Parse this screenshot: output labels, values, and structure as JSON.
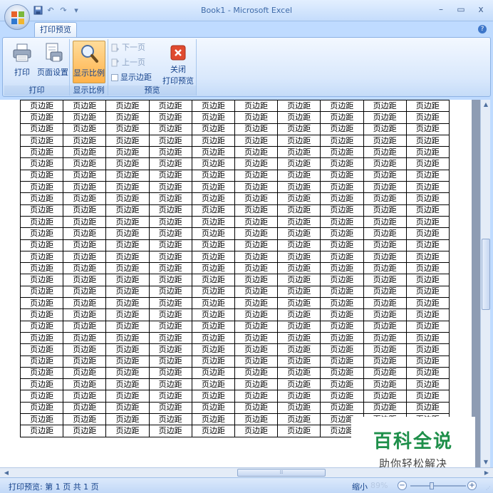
{
  "window": {
    "title": "Book1 - Microsoft Excel",
    "minimize": "–",
    "maximize": "▭",
    "close": "x"
  },
  "tabs": {
    "active": "打印预览",
    "help": "?"
  },
  "ribbon": {
    "print_group": {
      "label": "打印",
      "print_button": "打印",
      "page_setup_button": "页面设置"
    },
    "zoom_group": {
      "label": "显示比例",
      "zoom_button": "显示比例"
    },
    "preview_group": {
      "label": "预览",
      "next_page": "下一页",
      "prev_page": "上一页",
      "show_margins": "显示边距",
      "close_line1": "关闭",
      "close_line2": "打印预览"
    }
  },
  "sheet": {
    "cell_text": "页边距",
    "rows": 29,
    "cols": 10
  },
  "watermark": {
    "main": "百科全说",
    "sub": "助你轻松解决"
  },
  "status": {
    "text": "打印预览: 第 1 页 共 1 页",
    "zoom_label": "缩小",
    "zoom_value": "89%"
  },
  "colors": {
    "ribbon_bg": "#d9e8fc",
    "active_button": "#ffb24a",
    "watermark_green": "#1e8f4a",
    "close_red": "#e04a2f"
  }
}
